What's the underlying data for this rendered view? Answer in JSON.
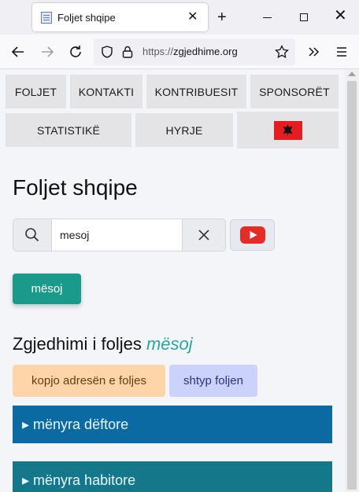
{
  "browser": {
    "tab_title": "Foljet shqipe",
    "url_scheme": "https://",
    "url_host": "zgjedhime.org"
  },
  "menu": {
    "row1": [
      "FOLJET",
      "KONTAKTI",
      "KONTRIBUESIT",
      "SPONSORËT"
    ],
    "row2": [
      "STATISTIKË",
      "HYRJE"
    ],
    "flag_icon": "albania-flag-icon"
  },
  "page": {
    "title": "Foljet shqipe",
    "search_value": "mesoj",
    "primary_button": "mësoj",
    "heading_prefix": "Zgjedhimi i foljes",
    "heading_verb": "mësoj",
    "copy_button": "kopjo adresën e foljes",
    "print_button": "shtyp foljen",
    "modes": [
      "▸ mënyra dëftore",
      "▸ mënyra habitore"
    ]
  },
  "colors": {
    "primary": "#1a9a8a",
    "accent_text": "#25a7a0",
    "mode1": "#0c6aa3",
    "mode2": "#14778a"
  }
}
